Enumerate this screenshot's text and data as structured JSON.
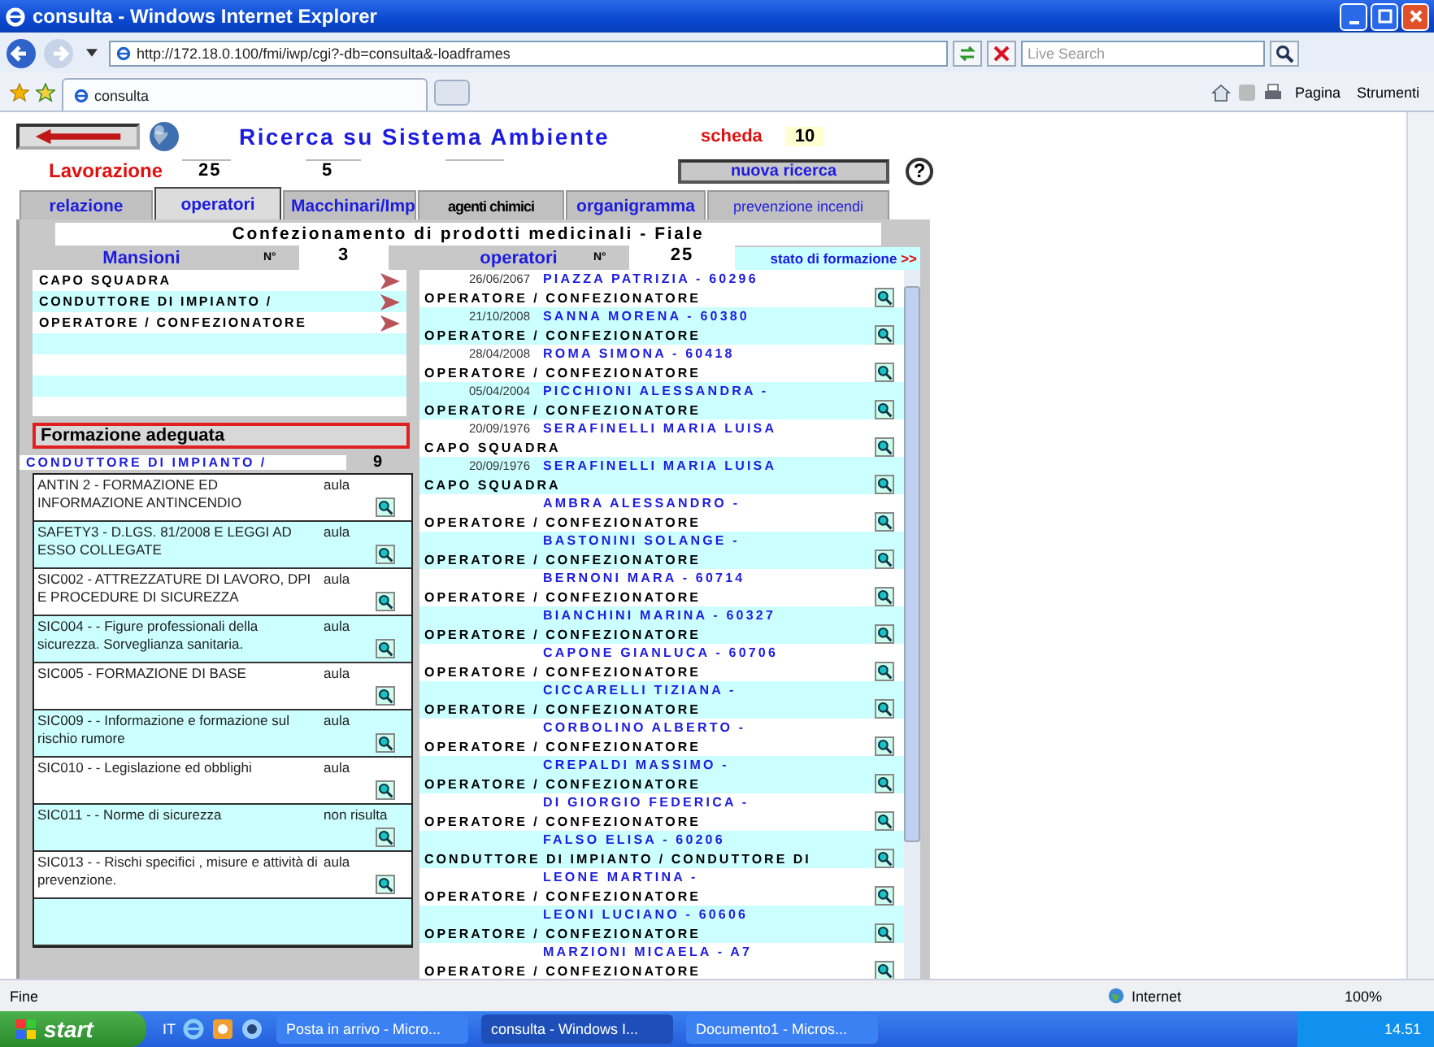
{
  "window": {
    "title": "consulta - Windows Internet Explorer"
  },
  "address_bar": {
    "url": "http://172.18.0.100/fmi/iwp/cgi?-db=consulta&-loadframes",
    "search_placeholder": "Live Search"
  },
  "browser_tabs": [
    {
      "label": "consulta",
      "selected": true
    }
  ],
  "command_bar": [
    "Pagina",
    "Strumenti"
  ],
  "page": {
    "title": "Ricerca su Sistema Ambiente",
    "scheda_label": "scheda",
    "scheda_value": "10",
    "lavorazione_label": "Lavorazione",
    "fields": [
      "25",
      "5"
    ],
    "new_search_button": "nuova ricerca",
    "help": "?",
    "tabs": [
      {
        "label": "relazione",
        "selected": false
      },
      {
        "label": "operatori",
        "selected": true
      },
      {
        "label": "Macchinari/Imp",
        "selected": false
      },
      {
        "label": "agenti chimici",
        "selected": false
      },
      {
        "label": "organigramma",
        "selected": false
      },
      {
        "label": "prevenzione incendi",
        "selected": false
      }
    ],
    "subtitle": "Confezionamento di prodotti medicinali - Fiale",
    "mansioni": {
      "header": "Mansioni",
      "count_label": "N°",
      "count": "3",
      "items": [
        "CAPO SQUADRA",
        "CONDUTTORE DI IMPIANTO /",
        "OPERATORE / CONFEZIONATORE"
      ]
    },
    "formazione": {
      "title": "Formazione adeguata",
      "role": "CONDUTTORE DI IMPIANTO /",
      "count": "9",
      "courses": [
        {
          "name": "ANTIN 2 - FORMAZIONE ED INFORMAZIONE ANTINCENDIO",
          "mode": "aula"
        },
        {
          "name": "SAFETY3 - D.LGS. 81/2008 E LEGGI AD ESSO COLLEGATE",
          "mode": "aula"
        },
        {
          "name": "SIC002 - ATTREZZATURE DI LAVORO, DPI E PROCEDURE DI SICUREZZA",
          "mode": "aula"
        },
        {
          "name": "SIC004 - - Figure professionali della sicurezza. Sorveglianza sanitaria.",
          "mode": "aula"
        },
        {
          "name": "SIC005 - FORMAZIONE DI BASE",
          "mode": "aula"
        },
        {
          "name": "SIC009 - - Informazione e formazione sul rischio rumore",
          "mode": "aula"
        },
        {
          "name": "SIC010 - - Legislazione ed obblighi",
          "mode": "aula"
        },
        {
          "name": "SIC011 - - Norme di sicurezza",
          "mode": "non risulta"
        },
        {
          "name": "SIC013 - - Rischi specifici , misure e attività di prevenzione.",
          "mode": "aula"
        }
      ]
    },
    "operatori": {
      "header": "operatori",
      "count_label": "N°",
      "count": "25",
      "link": "stato di formazione",
      "link_arrow": ">>",
      "rows": [
        {
          "date": "26/06/2067",
          "name": "PIAZZA PATRIZIA - 60296",
          "role": "OPERATORE / CONFEZIONATORE"
        },
        {
          "date": "21/10/2008",
          "name": "SANNA MORENA - 60380",
          "role": "OPERATORE / CONFEZIONATORE"
        },
        {
          "date": "28/04/2008",
          "name": "ROMA SIMONA - 60418",
          "role": "OPERATORE / CONFEZIONATORE"
        },
        {
          "date": "05/04/2004",
          "name": "PICCHIONI ALESSANDRA -",
          "role": "OPERATORE / CONFEZIONATORE"
        },
        {
          "date": "20/09/1976",
          "name": "SERAFINELLI MARIA LUISA",
          "role": "CAPO SQUADRA"
        },
        {
          "date": "20/09/1976",
          "name": "SERAFINELLI MARIA LUISA",
          "role": "CAPO SQUADRA"
        },
        {
          "name": "AMBRA ALESSANDRO -",
          "role": "OPERATORE / CONFEZIONATORE"
        },
        {
          "name": "BASTONINI SOLANGE -",
          "role": "OPERATORE / CONFEZIONATORE"
        },
        {
          "name": "BERNONI MARA - 60714",
          "role": "OPERATORE / CONFEZIONATORE"
        },
        {
          "name": "BIANCHINI MARINA - 60327",
          "role": "OPERATORE / CONFEZIONATORE"
        },
        {
          "name": "CAPONE GIANLUCA - 60706",
          "role": "OPERATORE / CONFEZIONATORE"
        },
        {
          "name": "CICCARELLI TIZIANA -",
          "role": "OPERATORE / CONFEZIONATORE"
        },
        {
          "name": "CORBOLINO ALBERTO -",
          "role": "OPERATORE / CONFEZIONATORE"
        },
        {
          "name": "CREPALDI MASSIMO -",
          "role": "OPERATORE / CONFEZIONATORE"
        },
        {
          "name": "DI GIORGIO FEDERICA -",
          "role": "OPERATORE / CONFEZIONATORE"
        },
        {
          "name": "FALSO ELISA - 60206",
          "role": "CONDUTTORE DI IMPIANTO / CONDUTTORE DI"
        },
        {
          "name": "LEONE MARTINA -",
          "role": "OPERATORE / CONFEZIONATORE"
        },
        {
          "name": "LEONI LUCIANO - 60606",
          "role": "OPERATORE / CONFEZIONATORE"
        },
        {
          "name": "MARZIONI MICAELA - A7",
          "role": "OPERATORE / CONFEZIONATORE"
        }
      ]
    }
  },
  "status_bar": {
    "text": "Fine",
    "zone": "Internet",
    "zoom": "100%"
  },
  "taskbar": {
    "start": "start",
    "language": "IT",
    "tasks": [
      {
        "label": "Posta in arrivo - Micro...",
        "selected": false
      },
      {
        "label": "consulta - Windows I...",
        "selected": true
      },
      {
        "label": "Documento1 - Micros...",
        "selected": false
      }
    ],
    "clock": "14.51"
  }
}
